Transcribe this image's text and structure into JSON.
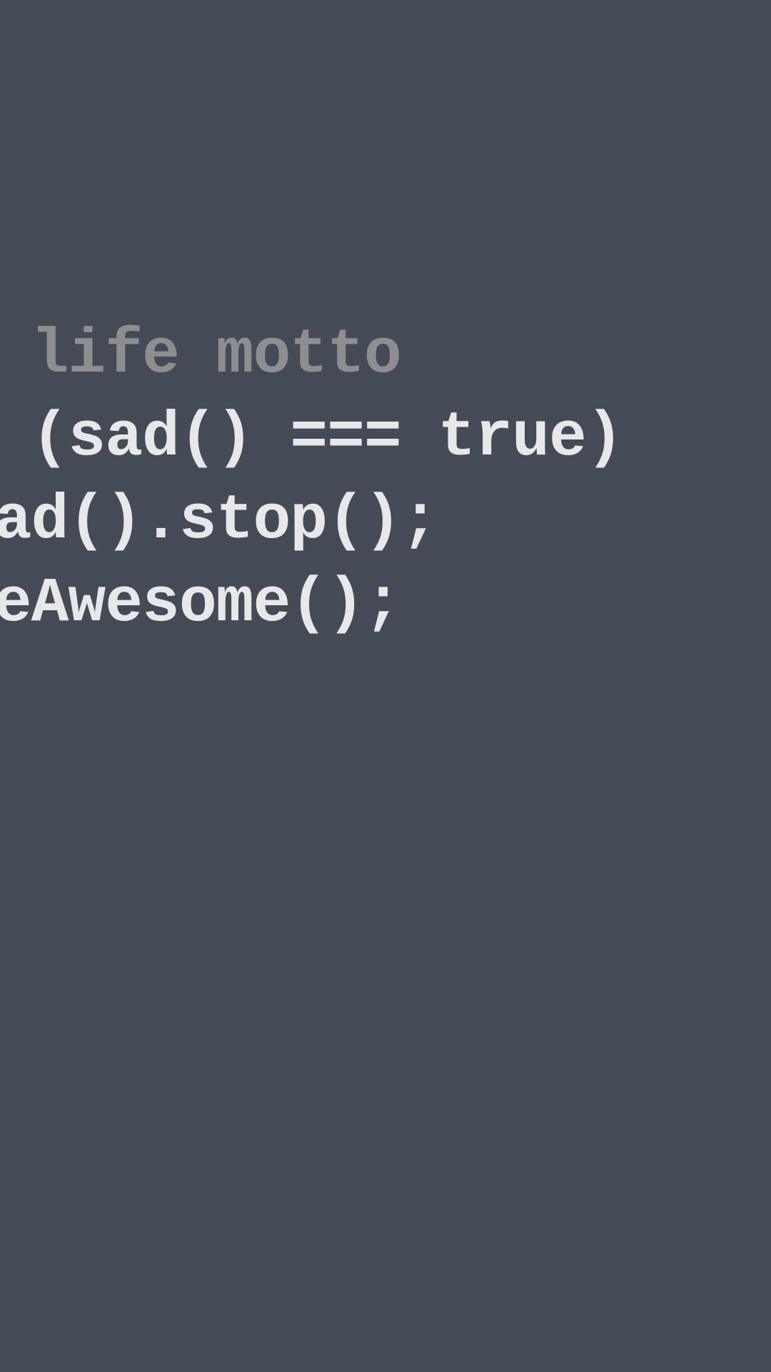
{
  "colors": {
    "background": "#444b57",
    "comment": "#8e8e8e",
    "code": "#e8e8e8"
  },
  "lines": {
    "comment": "/ life motto",
    "line1": "f (sad() === true)",
    "line2": "sad().stop();",
    "line3": "beAwesome();"
  }
}
